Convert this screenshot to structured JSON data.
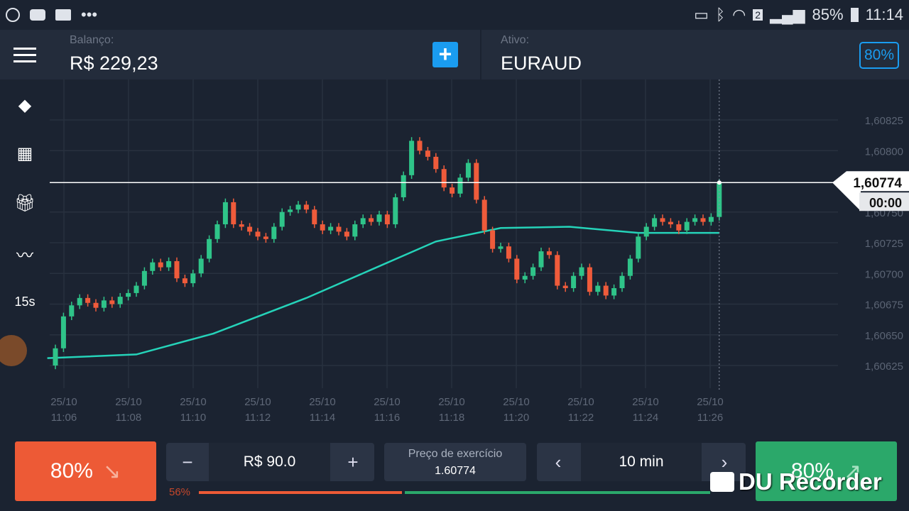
{
  "status_bar": {
    "battery": "85%",
    "time": "11:14",
    "sim": "2",
    "more": "•••"
  },
  "header": {
    "balance_label": "Balanço:",
    "balance": "R$ 229,23",
    "asset_label": "Ativo:",
    "asset": "EURAUD",
    "payout": "80%",
    "add": "+"
  },
  "sidebar": {
    "interval": "15s"
  },
  "chart_data": {
    "type": "candlestick",
    "asset": "EURAUD",
    "interval": "15s",
    "ylim": [
      1.60615,
      1.6084
    ],
    "y_ticks": [
      "1,60825",
      "1,60800",
      "1,60750",
      "1,60725",
      "1,60700",
      "1,60675",
      "1,60650",
      "1,60625"
    ],
    "y_tick_values": [
      1.60825,
      1.608,
      1.6075,
      1.60725,
      1.607,
      1.60675,
      1.6065,
      1.60625
    ],
    "x_ticks": [
      [
        "25/10",
        "11:06"
      ],
      [
        "25/10",
        "11:08"
      ],
      [
        "25/10",
        "11:10"
      ],
      [
        "25/10",
        "11:12"
      ],
      [
        "25/10",
        "11:14"
      ],
      [
        "25/10",
        "11:16"
      ],
      [
        "25/10",
        "11:18"
      ],
      [
        "25/10",
        "11:20"
      ],
      [
        "25/10",
        "11:22"
      ],
      [
        "25/10",
        "11:24"
      ],
      [
        "25/10",
        "11:26"
      ]
    ],
    "first_open": 1.60625,
    "closes": [
      1.60639,
      1.60665,
      1.60674,
      1.6068,
      1.60676,
      1.60672,
      1.60678,
      1.60675,
      1.60681,
      1.60684,
      1.6069,
      1.60702,
      1.60709,
      1.60705,
      1.6071,
      1.60696,
      1.60692,
      1.607,
      1.60712,
      1.60728,
      1.6074,
      1.60758,
      1.6074,
      1.60738,
      1.60734,
      1.6073,
      1.60728,
      1.60738,
      1.6075,
      1.60752,
      1.60756,
      1.60752,
      1.6074,
      1.60735,
      1.60738,
      1.60734,
      1.6073,
      1.6074,
      1.60745,
      1.60742,
      1.60748,
      1.6074,
      1.60762,
      1.6078,
      1.60808,
      1.608,
      1.60795,
      1.60785,
      1.6077,
      1.60765,
      1.60778,
      1.6079,
      1.6076,
      1.60735,
      1.6072,
      1.60722,
      1.60712,
      1.60695,
      1.60698,
      1.60705,
      1.60718,
      1.60715,
      1.6069,
      1.60688,
      1.60698,
      1.60705,
      1.60685,
      1.6069,
      1.60682,
      1.60688,
      1.60698,
      1.60712,
      1.6073,
      1.60738,
      1.60745,
      1.60742,
      1.6074,
      1.60735,
      1.60742,
      1.60745,
      1.60742,
      1.60746,
      1.60774
    ],
    "moving_average": [
      [
        -1,
        1.60631
      ],
      [
        10,
        1.60634
      ],
      [
        19.5,
        1.60651
      ],
      [
        31,
        1.6068
      ],
      [
        39,
        1.60703
      ],
      [
        47,
        1.60726
      ],
      [
        55,
        1.60737
      ],
      [
        63.5,
        1.60738
      ],
      [
        72,
        1.60733
      ],
      [
        82,
        1.60733
      ]
    ],
    "current_price": "1,60774",
    "countdown": "00:00",
    "colors": {
      "up": "#2fc489",
      "down": "#ef5b3b",
      "ma": "#25d3b9"
    }
  },
  "trade": {
    "down_payout": "80%",
    "up_payout": "80%",
    "minus": "−",
    "plus": "+",
    "amount": "R$ 90.0",
    "strike_label": "Preço de exercício",
    "strike": "1.60774",
    "prev": "‹",
    "next": "›",
    "duration": "10 min",
    "sentiment": "56%",
    "sentiment_value": 0.56
  },
  "overlay": {
    "watermark": "DU Recorder"
  }
}
